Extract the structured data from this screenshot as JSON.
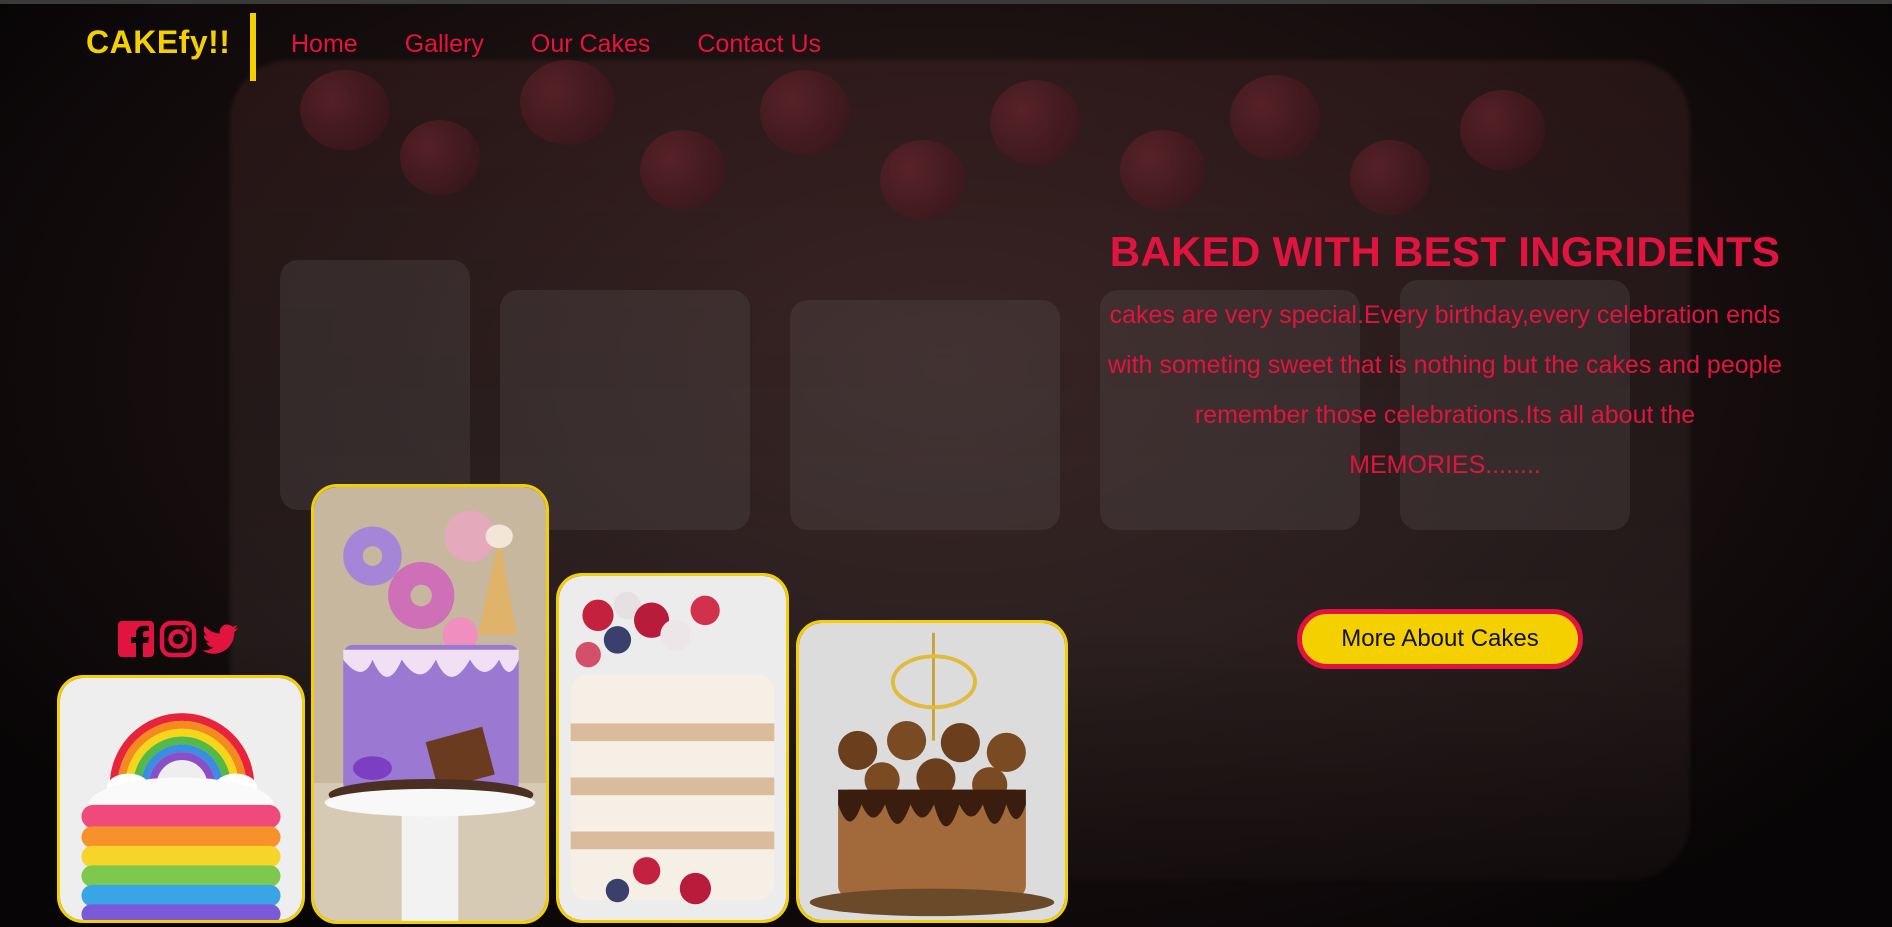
{
  "header": {
    "logo": "CAKEfy!!",
    "nav": [
      "Home",
      "Gallery",
      "Our Cakes",
      "Contact Us"
    ]
  },
  "hero": {
    "title": "BAKED WITH BEST INGRIDENTS",
    "lines": [
      "cakes are very special.Every birthday,every celebration ends",
      "with someting sweet that is nothing but the cakes and people",
      "remember those celebrations.Its all about the",
      "MEMORIES........"
    ],
    "button_label": "More About Cakes"
  },
  "social": [
    "facebook-icon",
    "instagram-icon",
    "twitter-icon"
  ],
  "cards": [
    "rainbow-cake",
    "purple-donut-cake",
    "naked-berry-cake",
    "chocolate-birthday-cake"
  ],
  "colors": {
    "accent_yellow": "#f5d000",
    "accent_red": "#e0143f",
    "background": "#0b0708"
  }
}
